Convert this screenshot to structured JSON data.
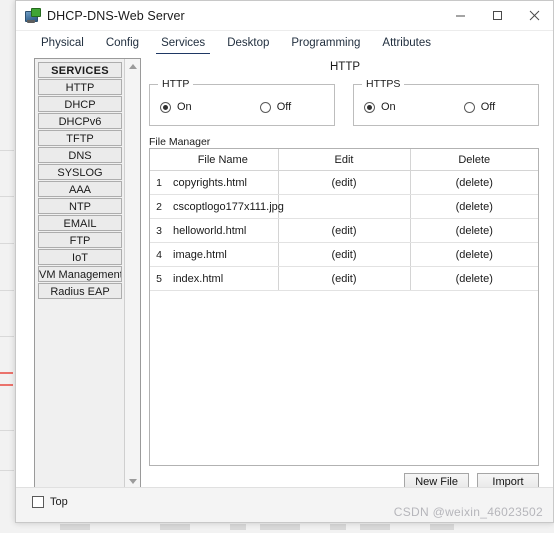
{
  "window": {
    "title": "DHCP-DNS-Web Server",
    "icon": "server-device-icon",
    "controls": {
      "minimize": "minimize-icon",
      "maximize": "maximize-icon",
      "close": "close-icon"
    }
  },
  "tabs": [
    {
      "label": "Physical",
      "active": false
    },
    {
      "label": "Config",
      "active": false
    },
    {
      "label": "Services",
      "active": true
    },
    {
      "label": "Desktop",
      "active": false
    },
    {
      "label": "Programming",
      "active": false
    },
    {
      "label": "Attributes",
      "active": false
    }
  ],
  "sidebar": {
    "items": [
      {
        "label": "SERVICES",
        "header": true
      },
      {
        "label": "HTTP",
        "header": false
      },
      {
        "label": "DHCP",
        "header": false
      },
      {
        "label": "DHCPv6",
        "header": false
      },
      {
        "label": "TFTP",
        "header": false
      },
      {
        "label": "DNS",
        "header": false
      },
      {
        "label": "SYSLOG",
        "header": false
      },
      {
        "label": "AAA",
        "header": false
      },
      {
        "label": "NTP",
        "header": false
      },
      {
        "label": "EMAIL",
        "header": false
      },
      {
        "label": "FTP",
        "header": false
      },
      {
        "label": "IoT",
        "header": false
      },
      {
        "label": "VM Management",
        "header": false
      },
      {
        "label": "Radius EAP",
        "header": false
      }
    ]
  },
  "main": {
    "panel_title": "HTTP",
    "groups": [
      {
        "legend": "HTTP",
        "options": [
          {
            "label": "On",
            "selected": true
          },
          {
            "label": "Off",
            "selected": false
          }
        ]
      },
      {
        "legend": "HTTPS",
        "options": [
          {
            "label": "On",
            "selected": true
          },
          {
            "label": "Off",
            "selected": false
          }
        ]
      }
    ],
    "file_manager": {
      "label": "File Manager",
      "columns": [
        "",
        "File Name",
        "Edit",
        "Delete"
      ],
      "rows": [
        {
          "index": "1",
          "name": "copyrights.html",
          "edit": "(edit)",
          "delete": "(delete)"
        },
        {
          "index": "2",
          "name": "cscoptlogo177x111.jpg",
          "edit": "",
          "delete": "(delete)"
        },
        {
          "index": "3",
          "name": "helloworld.html",
          "edit": "(edit)",
          "delete": "(delete)"
        },
        {
          "index": "4",
          "name": "image.html",
          "edit": "(edit)",
          "delete": "(delete)"
        },
        {
          "index": "5",
          "name": "index.html",
          "edit": "(edit)",
          "delete": "(delete)"
        }
      ],
      "buttons": [
        {
          "label": "New File"
        },
        {
          "label": "Import"
        }
      ]
    }
  },
  "bottom": {
    "top_checkbox": {
      "label": "Top",
      "checked": false
    },
    "watermark": "CSDN @weixin_46023502"
  },
  "colors": {
    "accent": "#1f3864",
    "window_bg": "#ffffff",
    "sidebar_item_bg": "#ebebeb",
    "border": "#9a9a9a"
  }
}
